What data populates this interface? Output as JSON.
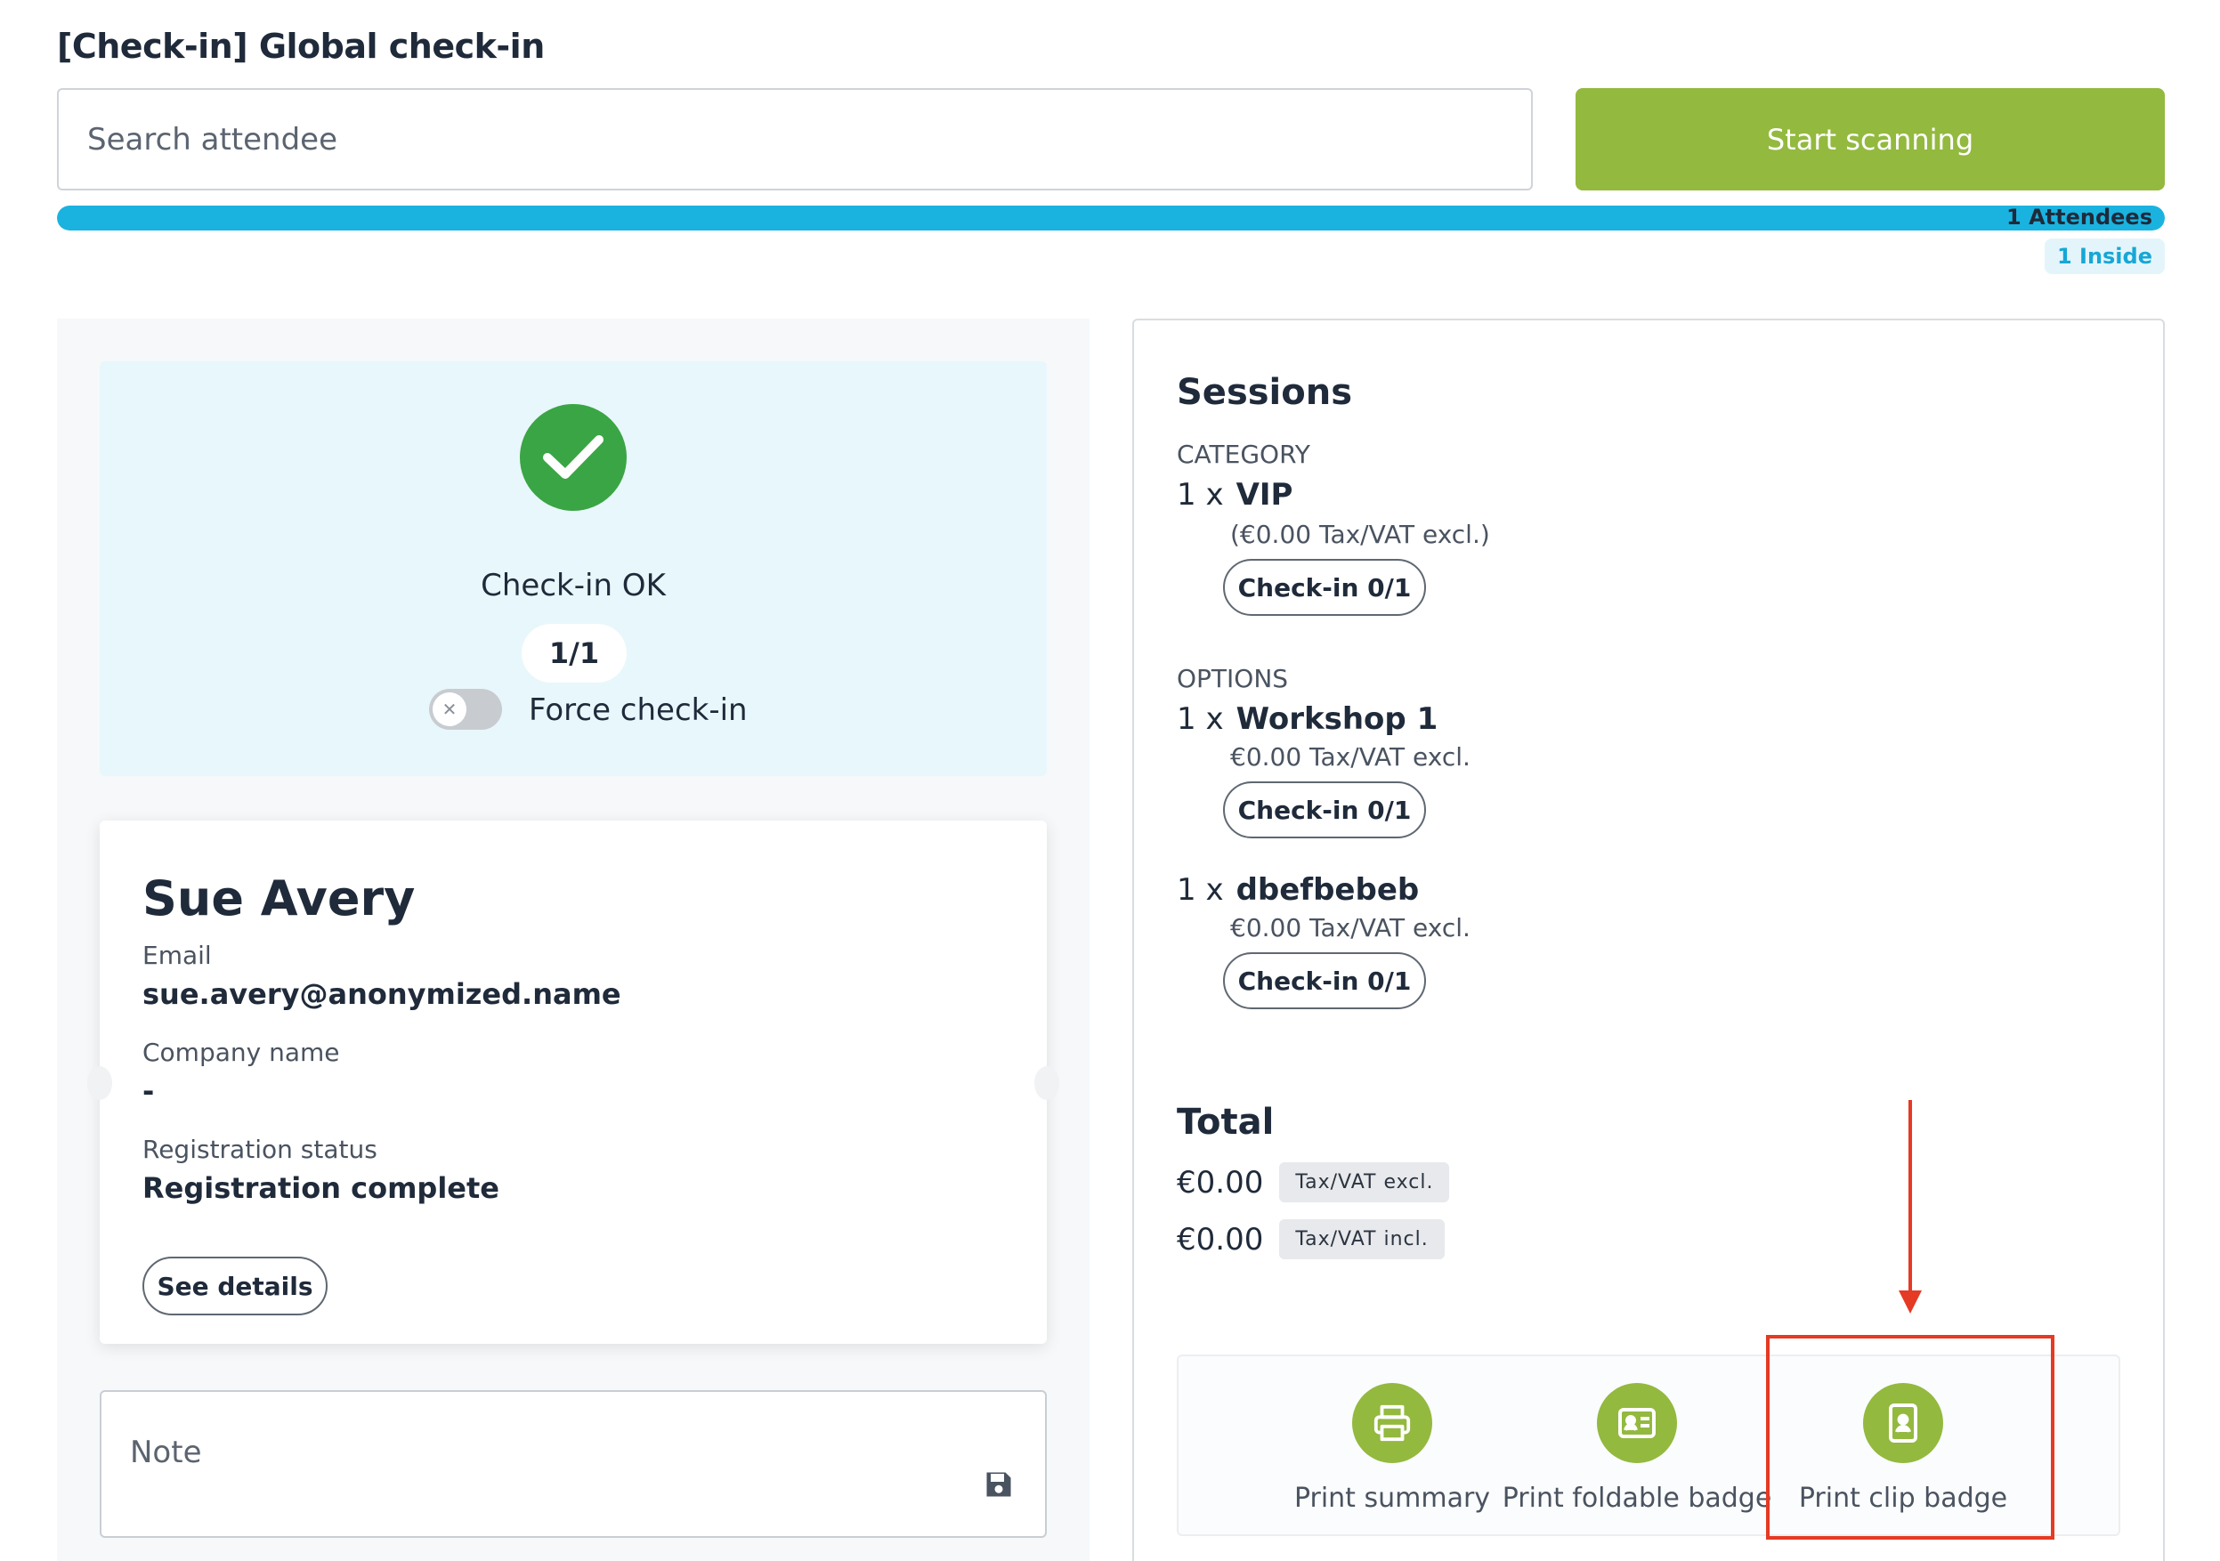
{
  "page": {
    "title": "[Check-in] Global check-in"
  },
  "search": {
    "placeholder": "Search attendee",
    "value": ""
  },
  "scan_button": {
    "label": "Start scanning"
  },
  "progress": {
    "fraction": 1.0,
    "attendees_label": "1 Attendees",
    "inside_label": "1 Inside"
  },
  "colors": {
    "accent_green": "#93b93f",
    "progress_blue": "#1ab3e0",
    "check_green": "#3aa544",
    "highlight_red": "#e53a24"
  },
  "checkin_status": {
    "icon": "checkmark-icon",
    "text": "Check-in OK",
    "count": "1/1",
    "force_toggle": {
      "label": "Force check-in",
      "checked": false
    }
  },
  "attendee": {
    "name": "Sue Avery",
    "email_label": "Email",
    "email": "sue.avery@anonymized.name",
    "company_label": "Company name",
    "company": "-",
    "status_label": "Registration status",
    "status": "Registration complete",
    "details_button": "See details"
  },
  "note": {
    "placeholder": "Note",
    "value": "",
    "save_icon": "save-icon"
  },
  "sessions": {
    "title": "Sessions",
    "category": {
      "label": "CATEGORY",
      "item": {
        "qty": "1 x",
        "name": "VIP",
        "price": "(€0.00 Tax/VAT excl.)",
        "checkin_button": "Check-in 0/1"
      }
    },
    "options": {
      "label": "OPTIONS",
      "items": [
        {
          "qty": "1 x",
          "name": "Workshop 1",
          "price": "€0.00 Tax/VAT excl.",
          "checkin_button": "Check-in 0/1"
        },
        {
          "qty": "1 x",
          "name": "dbefbebeb",
          "price": "€0.00 Tax/VAT excl.",
          "checkin_button": "Check-in 0/1"
        }
      ]
    }
  },
  "total": {
    "title": "Total",
    "rows": [
      {
        "amount": "€0.00",
        "badge": "Tax/VAT excl."
      },
      {
        "amount": "€0.00",
        "badge": "Tax/VAT incl."
      }
    ]
  },
  "print_actions": [
    {
      "label": "Print summary",
      "icon": "printer-icon"
    },
    {
      "label": "Print foldable badge",
      "icon": "id-card-icon"
    },
    {
      "label": "Print clip badge",
      "icon": "badge-icon"
    }
  ]
}
